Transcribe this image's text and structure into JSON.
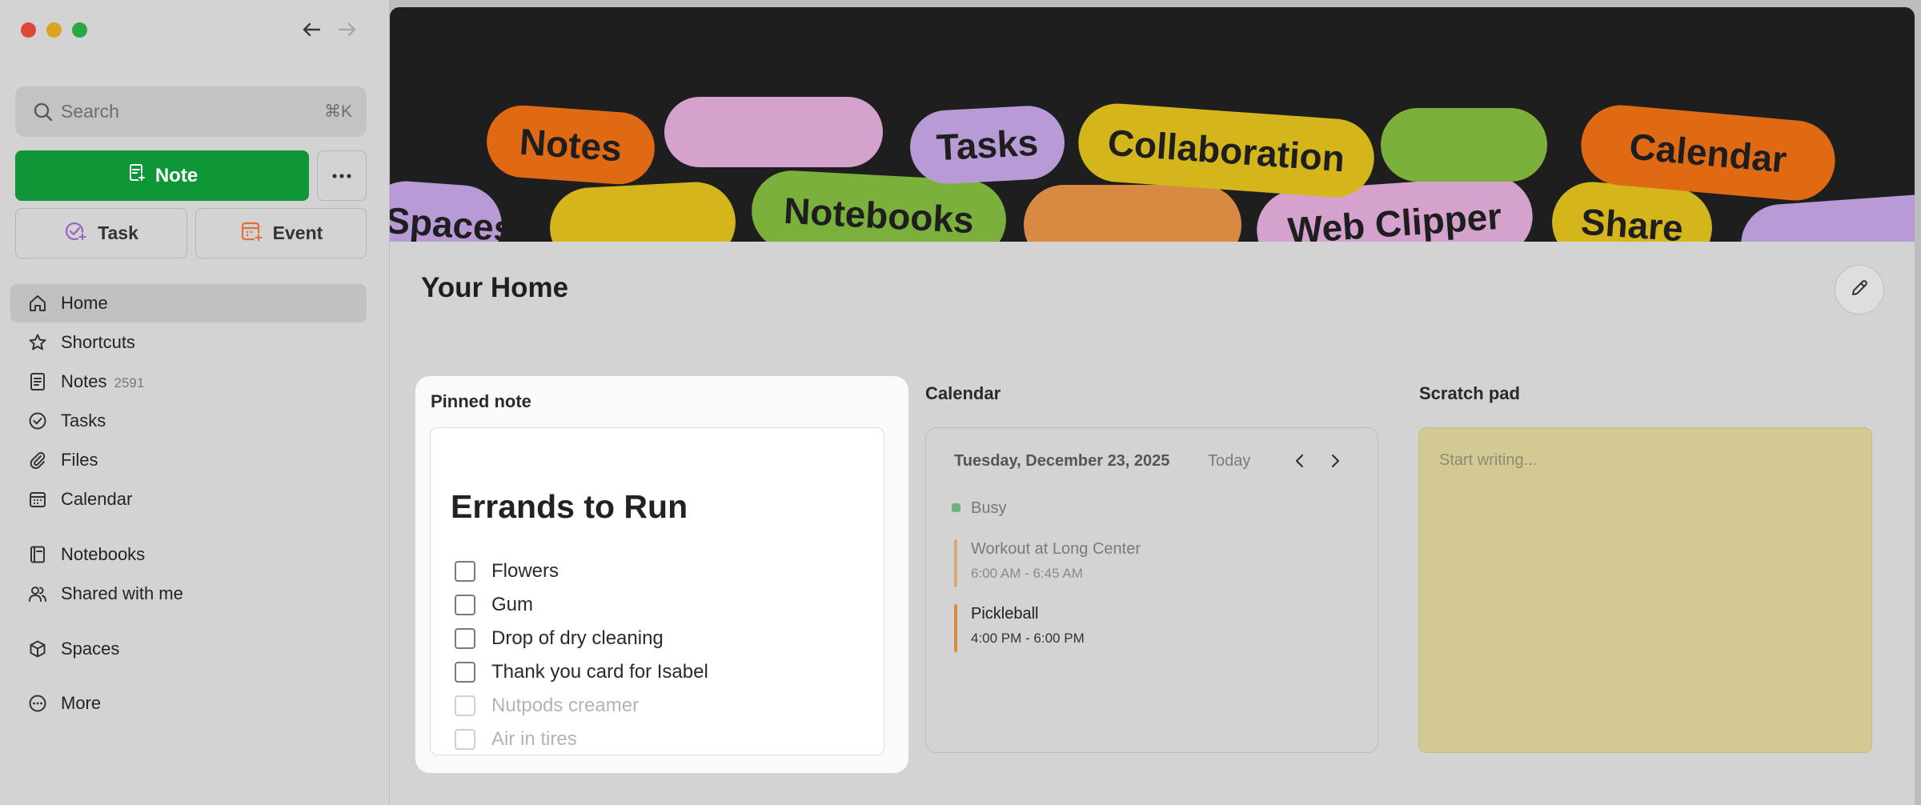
{
  "sidebar": {
    "search": {
      "placeholder": "Search",
      "shortcut": "⌘K"
    },
    "new_note_label": "Note",
    "task_label": "Task",
    "event_label": "Event",
    "nav": [
      {
        "label": "Home",
        "icon": "home-icon"
      },
      {
        "label": "Shortcuts",
        "icon": "star-icon"
      },
      {
        "label": "Notes",
        "count": "2591",
        "icon": "note-icon"
      },
      {
        "label": "Tasks",
        "icon": "check-circle-icon"
      },
      {
        "label": "Files",
        "icon": "paperclip-icon"
      },
      {
        "label": "Calendar",
        "icon": "calendar-icon"
      },
      {
        "label": "Notebooks",
        "icon": "notebook-icon"
      },
      {
        "label": "Shared with me",
        "icon": "people-icon"
      },
      {
        "label": "Spaces",
        "icon": "cube-icon"
      },
      {
        "label": "More",
        "icon": "more-circle-icon"
      }
    ]
  },
  "banner": {
    "pills": [
      "Notes",
      "Tasks",
      "Collaboration",
      "Calendar",
      "Spaces",
      "Notebooks",
      "Web Clipper",
      "Share"
    ]
  },
  "home": {
    "title": "Your Home"
  },
  "pinned": {
    "title": "Pinned note",
    "note_title": "Errands to Run",
    "items": [
      "Flowers",
      "Gum",
      "Drop of dry cleaning",
      "Thank you card for Isabel",
      "Nutpods creamer",
      "Air in tires"
    ]
  },
  "calendar": {
    "title": "Calendar",
    "date": "Tuesday, December 23, 2025",
    "today_label": "Today",
    "busy_label": "Busy",
    "events": [
      {
        "title": "Workout at Long Center",
        "time": "6:00 AM - 6:45 AM",
        "color": "#d9a877"
      },
      {
        "title": "Pickleball",
        "time": "4:00 PM - 6:00 PM",
        "color": "#d98a3c"
      }
    ]
  },
  "scratch": {
    "title": "Scratch pad",
    "placeholder": "Start writing..."
  },
  "colors": {
    "accent_green": "#0e9637",
    "banner_bg": "#1e1e1e",
    "scratch_bg": "#d2ca92"
  }
}
